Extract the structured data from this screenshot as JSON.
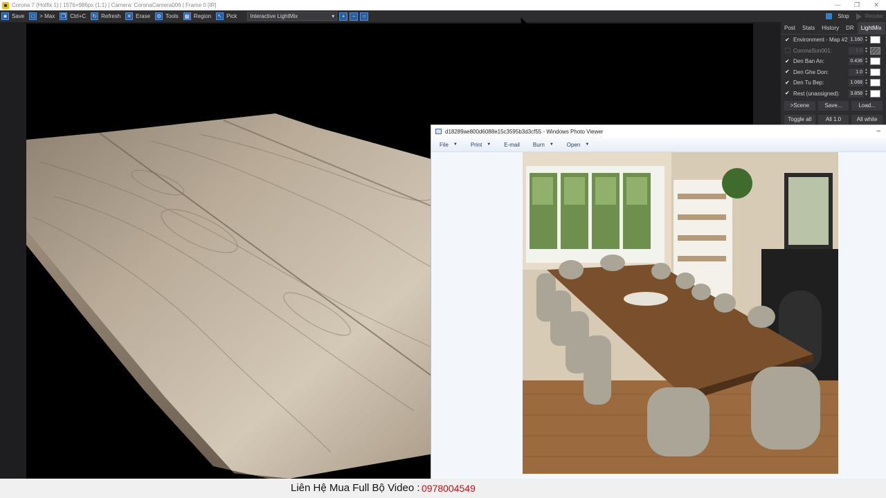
{
  "vfb": {
    "title": "Corona 7 (Hotfix 1) | 1576×986px (1:1) | Camera: CoronaCamera006 | Frame 0 [IR]",
    "window_controls": [
      "—",
      "❐",
      "✕"
    ],
    "toolbar": {
      "items": [
        {
          "label": "Save",
          "icon": "save-icon"
        },
        {
          "label": "> Max",
          "icon": "max-icon"
        },
        {
          "label": "Ctrl+C",
          "icon": "copy-icon"
        },
        {
          "label": "Refresh",
          "icon": "refresh-icon"
        },
        {
          "label": "Erase",
          "icon": "erase-icon"
        },
        {
          "label": "Tools",
          "icon": "tools-icon"
        },
        {
          "label": "Region",
          "icon": "region-icon"
        },
        {
          "label": "Pick",
          "icon": "pick-icon"
        }
      ],
      "display_mode": "Interactive LightMix",
      "stop_label": "Stop",
      "render_label": "Render"
    },
    "tabs": [
      "Post",
      "Stats",
      "History",
      "DR",
      "LightMix"
    ],
    "active_tab": "LightMix",
    "lightmix": [
      {
        "name": "Environment - Map #2",
        "checked": true,
        "value": "1.160",
        "swatch": "#ffffff"
      },
      {
        "name": "CoronaSun001:",
        "checked": false,
        "value": "1.0",
        "swatch": "hatch"
      },
      {
        "name": "Den Ban An:",
        "checked": true,
        "value": "0.436",
        "swatch": "#ffffff"
      },
      {
        "name": "Den Ghe Don:",
        "checked": true,
        "value": "1.0",
        "swatch": "#ffffff"
      },
      {
        "name": "Den Tu Bep:",
        "checked": true,
        "value": "1.068",
        "swatch": "#ffffff"
      },
      {
        "name": "Rest (unassigned):",
        "checked": true,
        "value": "3.858",
        "swatch": "#ffffff"
      }
    ],
    "buttons_row1": [
      ">Scene",
      "Save...",
      "Load..."
    ],
    "buttons_row2": [
      "Toggle all",
      "All 1.0",
      "All white"
    ]
  },
  "viewer": {
    "title": "d18289ae800d6088e15c3595b3d3cf55 - Windows Photo Viewer",
    "close": "–",
    "menu": [
      {
        "label": "File",
        "has_dropdown": true
      },
      {
        "label": "Print",
        "has_dropdown": true
      },
      {
        "label": "E-mail",
        "has_dropdown": false
      },
      {
        "label": "Burn",
        "has_dropdown": true
      },
      {
        "label": "Open",
        "has_dropdown": true
      }
    ]
  },
  "footer": {
    "label": "Liên Hệ Mua Full Bộ Video :",
    "phone": "0978004549"
  }
}
